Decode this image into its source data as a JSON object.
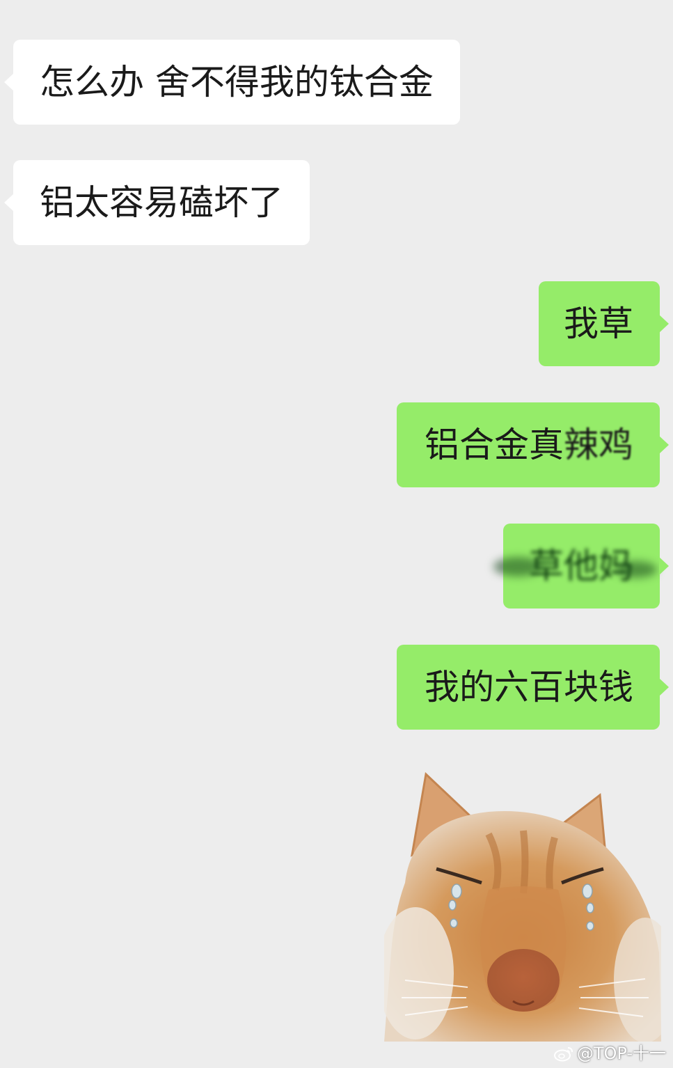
{
  "messages": [
    {
      "direction": "incoming",
      "text": "怎么办 舍不得我的钛合金"
    },
    {
      "direction": "incoming",
      "text": "铝太容易磕坏了"
    },
    {
      "direction": "outgoing",
      "text": "我草"
    },
    {
      "direction": "outgoing",
      "text_visible": "铝合金真",
      "text_obscured": "辣鸡"
    },
    {
      "direction": "outgoing",
      "text_obscured": "草他妈"
    },
    {
      "direction": "outgoing",
      "text": "我的六百块钱"
    }
  ],
  "sticker": {
    "icon": "crying-cat-sticker"
  },
  "watermark": {
    "text": "@TOP-十一",
    "icon": "weibo-icon"
  },
  "colors": {
    "background": "#ededed",
    "incoming_bubble": "#ffffff",
    "outgoing_bubble": "#95ec69"
  }
}
